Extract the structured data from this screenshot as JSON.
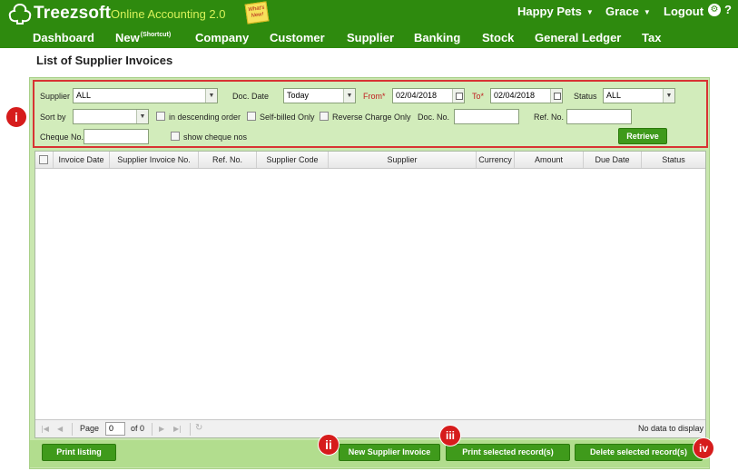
{
  "header": {
    "brand": "Treezsoft",
    "app_name": "Online Accounting 2.0",
    "whats_new": "What's New!",
    "company": "Happy Pets",
    "user": "Grace",
    "logout": "Logout",
    "help": "?"
  },
  "nav": {
    "items": [
      "Dashboard",
      "New",
      "Company",
      "Customer",
      "Supplier",
      "Banking",
      "Stock",
      "General Ledger",
      "Tax"
    ],
    "shortcut_sup": "(Shortcut)"
  },
  "page": {
    "title": "List of Supplier Invoices"
  },
  "filters": {
    "supplier_label": "Supplier",
    "supplier_value": "ALL",
    "doc_date_label": "Doc. Date",
    "doc_date_value": "Today",
    "from_label": "From*",
    "from_value": "02/04/2018",
    "to_label": "To*",
    "to_value": "02/04/2018",
    "status_label": "Status",
    "status_value": "ALL",
    "sort_by_label": "Sort by",
    "sort_by_value": "",
    "descending_label": "in descending order",
    "self_billed_label": "Self-billed Only",
    "reverse_charge_label": "Reverse Charge Only",
    "doc_no_label": "Doc. No.",
    "doc_no_value": "",
    "ref_no_label": "Ref. No.",
    "ref_no_value": "",
    "cheque_no_label": "Cheque No.",
    "cheque_no_value": "",
    "show_cheque_label": "show cheque nos",
    "retrieve_label": "Retrieve"
  },
  "grid": {
    "columns": [
      "Invoice Date",
      "Supplier Invoice No.",
      "Ref. No.",
      "Supplier Code",
      "Supplier",
      "Currency",
      "Amount",
      "Due Date",
      "Status"
    ],
    "rows": [],
    "pager": {
      "page_label": "Page",
      "page_value": "0",
      "of_label": "of 0",
      "empty_message": "No data to display"
    }
  },
  "actions": {
    "print_listing": "Print listing",
    "new_invoice": "New Supplier Invoice",
    "print_selected": "Print selected record(s)",
    "delete_selected": "Delete selected record(s)"
  },
  "markers": [
    "i",
    "ii",
    "iii",
    "iv"
  ],
  "colors": {
    "header_green": "#2e8a0e",
    "panel_green": "#c9e7af",
    "button_green": "#3f9a1b",
    "marker_red": "#d61c1c",
    "app_name_yellow": "#d8f25a"
  }
}
